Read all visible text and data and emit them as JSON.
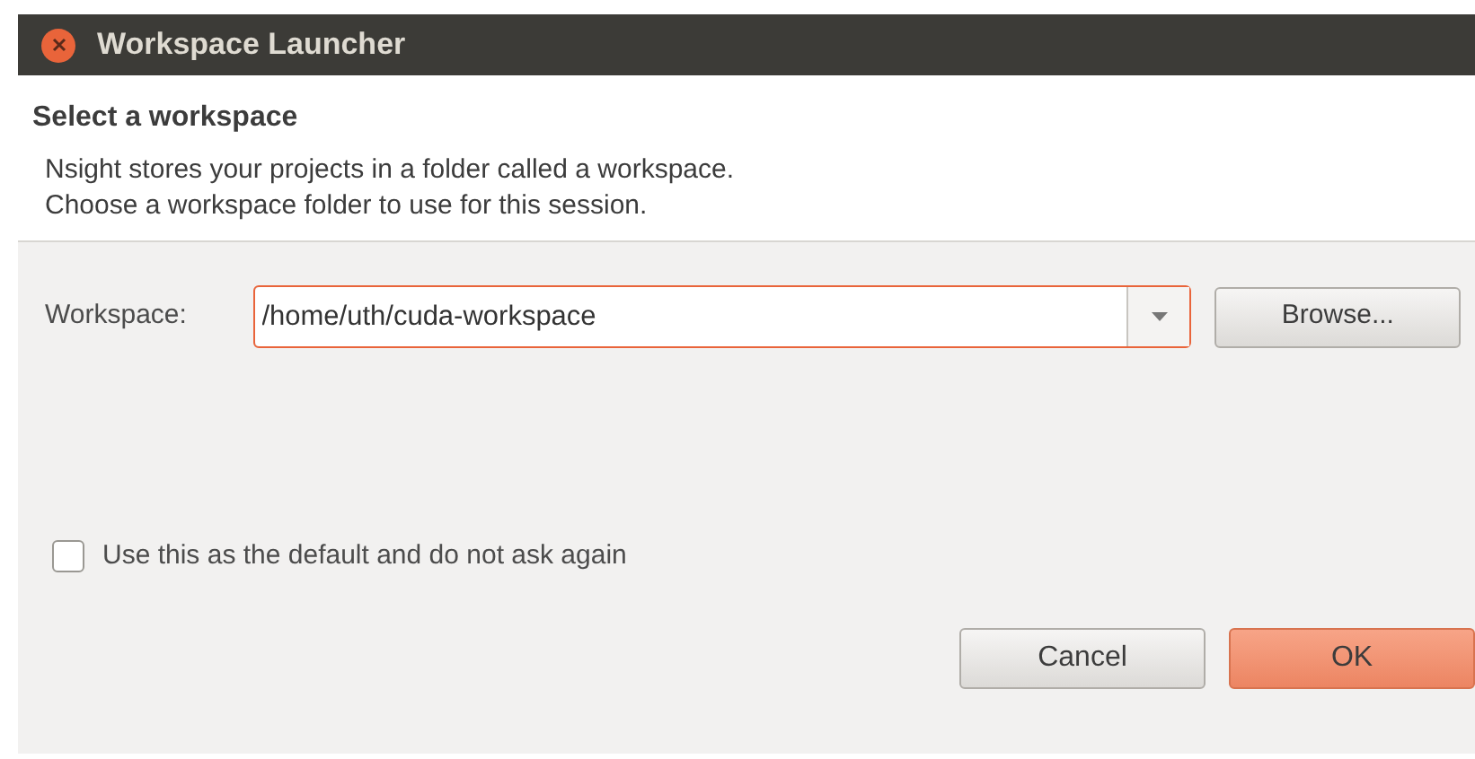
{
  "window": {
    "title": "Workspace Launcher"
  },
  "header": {
    "title": "Select a workspace",
    "lines": [
      "Nsight stores your projects in a folder called a workspace.",
      "Choose a workspace folder to use for this session."
    ]
  },
  "workspace": {
    "label": "Workspace:",
    "value": "/home/uth/cuda-workspace",
    "focused": true
  },
  "browse_button": "Browse...",
  "default_checkbox": {
    "label": "Use this as the default and do not ask again",
    "checked": false
  },
  "buttons": [
    {
      "label": "Cancel",
      "primary": false
    },
    {
      "label": "OK",
      "primary": true
    }
  ]
}
